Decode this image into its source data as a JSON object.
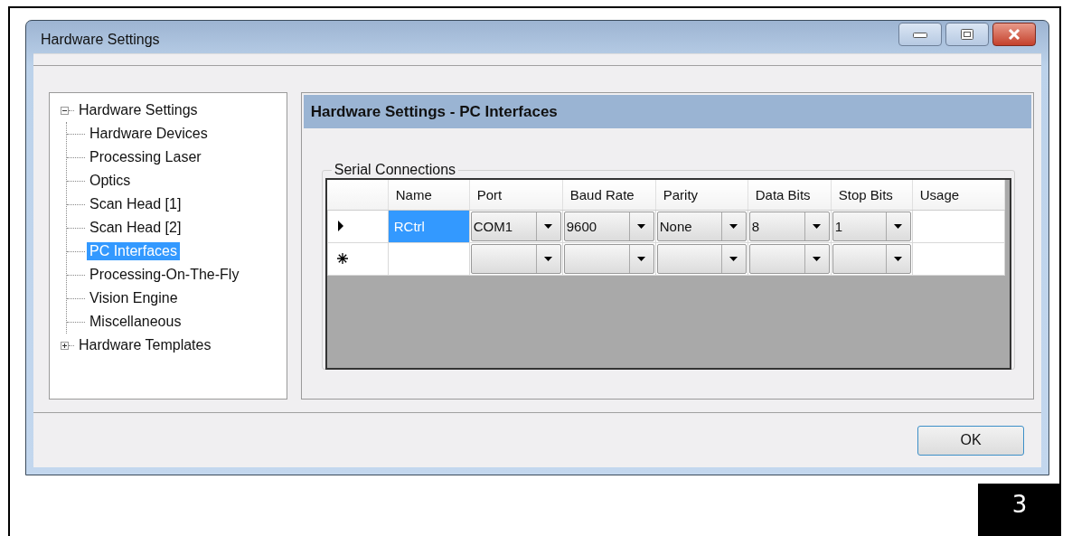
{
  "window": {
    "title": "Hardware Settings"
  },
  "tree": [
    {
      "label": "Hardware Settings",
      "expanded": true,
      "selected": false,
      "children": [
        {
          "label": "Hardware Devices",
          "selected": false
        },
        {
          "label": "Processing Laser",
          "selected": false
        },
        {
          "label": "Optics",
          "selected": false
        },
        {
          "label": "Scan Head [1]",
          "selected": false
        },
        {
          "label": "Scan Head [2]",
          "selected": false
        },
        {
          "label": "PC Interfaces",
          "selected": true
        },
        {
          "label": "Processing-On-The-Fly",
          "selected": false
        },
        {
          "label": "Vision Engine",
          "selected": false
        },
        {
          "label": "Miscellaneous",
          "selected": false
        }
      ]
    },
    {
      "label": "Hardware Templates",
      "expanded": false,
      "selected": false
    }
  ],
  "panel": {
    "title": "Hardware Settings - PC Interfaces",
    "group": "Serial Connections",
    "table": {
      "columns": [
        "Name",
        "Port",
        "Baud Rate",
        "Parity",
        "Data Bits",
        "Stop Bits",
        "Usage"
      ],
      "rows": [
        {
          "kind": "current",
          "cells": [
            {
              "kind": "text",
              "value": "RCtrl",
              "selected": true
            },
            {
              "kind": "combo",
              "value": "COM1",
              "selected": false
            },
            {
              "kind": "combo",
              "value": "9600",
              "selected": false
            },
            {
              "kind": "combo",
              "value": "None",
              "selected": false
            },
            {
              "kind": "combo",
              "value": "8",
              "selected": false
            },
            {
              "kind": "combo",
              "value": "1",
              "selected": false
            },
            {
              "kind": "text",
              "selected": false
            }
          ]
        },
        {
          "kind": "new",
          "cells": [
            {
              "kind": "text",
              "selected": false
            },
            {
              "kind": "combo",
              "selected": false
            },
            {
              "kind": "combo",
              "selected": false
            },
            {
              "kind": "combo",
              "selected": false
            },
            {
              "kind": "combo",
              "selected": false
            },
            {
              "kind": "combo",
              "selected": false
            },
            {
              "kind": "text",
              "selected": false
            }
          ]
        }
      ]
    }
  },
  "buttons": [
    "OK"
  ],
  "page_number": "3"
}
